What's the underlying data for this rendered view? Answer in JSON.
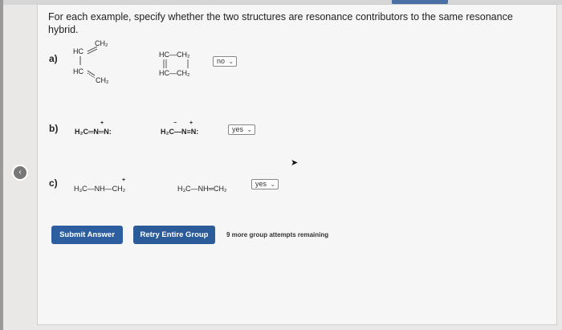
{
  "question": {
    "instructions": "For each example, specify whether the two structures are resonance contributors to the same resonance hybrid."
  },
  "items": [
    {
      "label": "a)",
      "left_top": "HC",
      "left_top_r": "CH₂",
      "left_bot": "HC",
      "left_bot_r": "CH₂",
      "right_top": "HC—CH₂",
      "right_bot": "HC—CH₂",
      "answer": "no"
    },
    {
      "label": "b)",
      "left": "H₂C═N═N:",
      "left_charge": "+",
      "right": "H₂C—N≡N:",
      "right_charge1": "−",
      "right_charge2": "+",
      "answer": "yes"
    },
    {
      "label": "c)",
      "left": "H₃C—NH—CH₂",
      "left_charge": "+",
      "right": "H₃C—NH═CH₂",
      "answer": "yes"
    }
  ],
  "actions": {
    "submit_label": "Submit Answer",
    "retry_label": "Retry Entire Group",
    "attempts_text": "9 more group attempts remaining"
  },
  "icons": {
    "dropdown": "chevron-down-icon",
    "toggle": "chevron-icon",
    "cursor": "mouse-pointer-icon"
  },
  "colors": {
    "button": "#2d5fa0",
    "panel": "#f6f6f6"
  }
}
